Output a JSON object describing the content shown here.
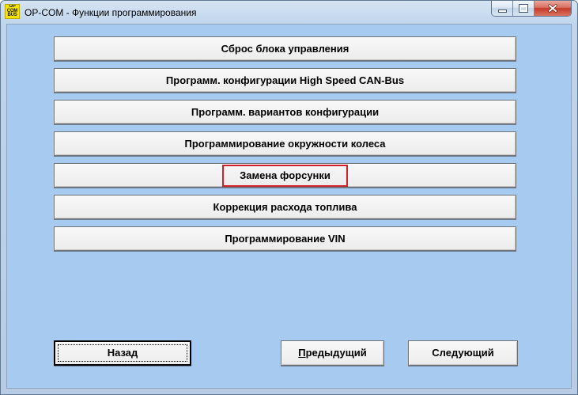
{
  "window": {
    "title": "OP-COM - Функции программирования",
    "logo": {
      "icon": "op-com-logo-icon",
      "lines": [
        "OP",
        "COM",
        "BUS"
      ]
    },
    "controls": [
      {
        "name": "minimize",
        "icon": "minimize-icon"
      },
      {
        "name": "maximize",
        "icon": "maximize-icon"
      },
      {
        "name": "close",
        "icon": "close-icon"
      }
    ]
  },
  "functions": [
    {
      "label": "Сброс блока управления",
      "highlighted": false
    },
    {
      "label": "Программ. конфигурации High Speed CAN-Bus",
      "highlighted": false
    },
    {
      "label": "Программ. вариантов конфигурации",
      "highlighted": false
    },
    {
      "label": "Программирование окружности колеса",
      "highlighted": false
    },
    {
      "label": "Замена форсунки",
      "highlighted": true
    },
    {
      "label": "Коррекция расхода топлива",
      "highlighted": false
    },
    {
      "label": "Программирование VIN",
      "highlighted": false
    }
  ],
  "navigation": {
    "back_label": "Назад",
    "back_focused": true,
    "previous_label": "Предыдущий",
    "next_label": "Следующий"
  },
  "colors": {
    "client_background": "#a6caf0",
    "highlight_border": "#d0212a",
    "close_button": "#c63a2b",
    "logo_background": "#f5e400"
  }
}
